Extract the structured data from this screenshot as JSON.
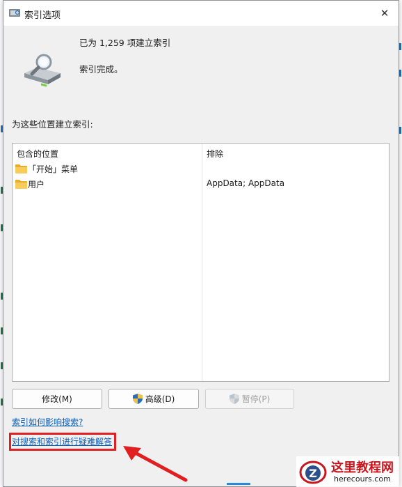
{
  "window": {
    "title": "索引选项",
    "close_glyph": "✕"
  },
  "status": {
    "count_text": "已为 1,259 项建立索引",
    "state_text": "索引完成。"
  },
  "locations": {
    "section_label": "为这些位置建立索引:",
    "col_included": "包含的位置",
    "col_excluded": "排除",
    "rows": [
      {
        "name": "「开始」菜单",
        "exclude": ""
      },
      {
        "name": "用户",
        "exclude": "AppData; AppData"
      }
    ]
  },
  "buttons": {
    "modify": "修改(M)",
    "advanced": "高级(D)",
    "pause": "暂停(P)"
  },
  "links": {
    "how_affects": "索引如何影响搜索?",
    "troubleshoot": "对搜索和索引进行疑难解答"
  },
  "watermark": {
    "logo_letter": "Z",
    "name": "这里教程网",
    "url": "herecours.com"
  },
  "colors": {
    "link": "#0b5fb8",
    "highlight": "#e02020",
    "folder": "#f2c04a"
  },
  "icons": [
    "index-options-icon",
    "close-icon",
    "drive-search-icon",
    "folder-icon",
    "shield-icon",
    "arrow-icon"
  ]
}
